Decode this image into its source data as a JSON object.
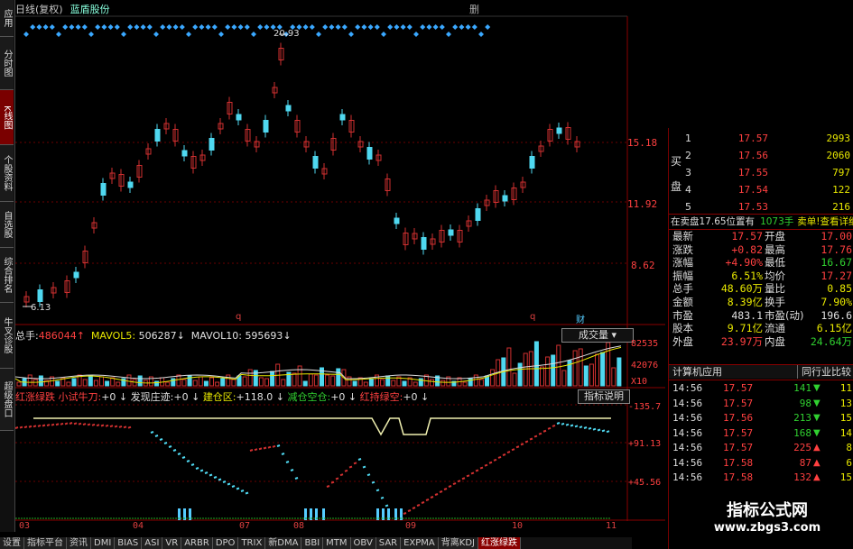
{
  "header": {
    "title": "日线(复权)",
    "symbol": "蓝盾股份",
    "corner": "删"
  },
  "leftnav": [
    {
      "label": "应用",
      "active": false
    },
    {
      "label": "分时图",
      "active": false
    },
    {
      "label": "K线图",
      "active": true
    },
    {
      "label": "个股资料",
      "active": false
    },
    {
      "label": "自选股",
      "active": false
    },
    {
      "label": "综合排名",
      "active": false
    },
    {
      "label": "牛叉诊股",
      "active": false
    },
    {
      "label": "超级盘口",
      "active": false
    }
  ],
  "price_axis": {
    "labels": [
      "15.18",
      "11.92",
      "8.62"
    ],
    "high_mark": "20.93",
    "low_mark": "6.13",
    "markers": [
      "q",
      "q",
      "财"
    ]
  },
  "volume": {
    "label": "总手:",
    "value": "486044",
    "ma5_label": "MAVOL5:",
    "ma5_value": "506287",
    "ma10_label": "MAVOL10:",
    "ma10_value": "595693",
    "dropdown": "成交量",
    "axis": [
      "82535",
      "42076",
      "X10"
    ]
  },
  "indicator": {
    "name": "红涨绿跌",
    "items": [
      {
        "label": "小试牛刀:",
        "value": "+0"
      },
      {
        "label": "发现庄迹:",
        "value": "+0"
      },
      {
        "label": "建仓区:",
        "value": "+118.0"
      },
      {
        "label": "减仓空仓:",
        "value": "+0"
      },
      {
        "label": "红持绿空:",
        "value": "+0"
      }
    ],
    "button": "指标说明",
    "axis": [
      "135.7",
      "91.13",
      "45.56"
    ]
  },
  "xaxis": [
    "03",
    "04",
    "07",
    "08",
    "09",
    "10",
    "11"
  ],
  "bottom_tabs": [
    "设置",
    "指标平台",
    "资讯",
    "DMI",
    "BIAS",
    "ASI",
    "VR",
    "ARBR",
    "DPO",
    "TRIX",
    "新DMA",
    "BBI",
    "MTM",
    "OBV",
    "SAR",
    "EXPMA",
    "背离KDJ",
    "红涨绿跌"
  ],
  "orderbook": {
    "side_label_top": "买",
    "side_label_bottom": "盘",
    "rows": [
      {
        "level": "1",
        "price": "17.57",
        "vol": "2993"
      },
      {
        "level": "2",
        "price": "17.56",
        "vol": "2060"
      },
      {
        "level": "3",
        "price": "17.55",
        "vol": "797"
      },
      {
        "level": "4",
        "price": "17.54",
        "vol": "122"
      },
      {
        "level": "5",
        "price": "17.53",
        "vol": "216"
      }
    ],
    "note": "在卖盘17.65位置有",
    "note_vol": "1073手",
    "note_action": "卖单!查看详细"
  },
  "quote": [
    {
      "k1": "最新",
      "v1": "17.57",
      "c1": "red",
      "k2": "开盘",
      "v2": "17.00",
      "c2": "red"
    },
    {
      "k1": "涨跌",
      "v1": "+0.82",
      "c1": "red",
      "k2": "最高",
      "v2": "17.76",
      "c2": "red"
    },
    {
      "k1": "涨幅",
      "v1": "+4.90%",
      "c1": "red",
      "k2": "最低",
      "v2": "16.67",
      "c2": "green"
    },
    {
      "k1": "振幅",
      "v1": "6.51%",
      "c1": "yellow",
      "k2": "均价",
      "v2": "17.27",
      "c2": "red"
    },
    {
      "k1": "总手",
      "v1": "48.60万",
      "c1": "yellow",
      "k2": "量比",
      "v2": "0.85",
      "c2": "yellow"
    },
    {
      "k1": "金额",
      "v1": "8.39亿",
      "c1": "yellow",
      "k2": "换手",
      "v2": "7.90%",
      "c2": "yellow"
    },
    {
      "k1": "市盈",
      "v1": "483.1",
      "c1": "white",
      "k2": "市盈(动)",
      "v2": "196.6",
      "c2": "white"
    },
    {
      "k1": "股本",
      "v1": "9.71亿",
      "c1": "yellow",
      "k2": "流通",
      "v2": "6.15亿",
      "c2": "yellow"
    },
    {
      "k1": "外盘",
      "v1": "23.97万",
      "c1": "red",
      "k2": "内盘",
      "v2": "24.64万",
      "c2": "green"
    }
  ],
  "industry": {
    "left": "计算机应用",
    "right": "同行业比较"
  },
  "ticks": [
    {
      "time": "14:56",
      "price": "17.57",
      "vol": "141",
      "dir": "down",
      "num": "11"
    },
    {
      "time": "14:56",
      "price": "17.57",
      "vol": "98",
      "dir": "down",
      "num": "13"
    },
    {
      "time": "14:56",
      "price": "17.56",
      "vol": "213",
      "dir": "down",
      "num": "15"
    },
    {
      "time": "14:56",
      "price": "17.57",
      "vol": "168",
      "dir": "down",
      "num": "14"
    },
    {
      "time": "14:56",
      "price": "17.57",
      "vol": "225",
      "dir": "up",
      "num": "8"
    },
    {
      "time": "14:56",
      "price": "17.58",
      "vol": "87",
      "dir": "up",
      "num": "6"
    },
    {
      "time": "14:56",
      "price": "17.58",
      "vol": "132",
      "dir": "up",
      "num": "15"
    }
  ],
  "watermark": {
    "line1": "指标公式网",
    "line2": "www.zbgs3.com"
  },
  "colors": {
    "up": "#d03030",
    "down": "#4fd8f0",
    "grid": "#6a0000"
  }
}
